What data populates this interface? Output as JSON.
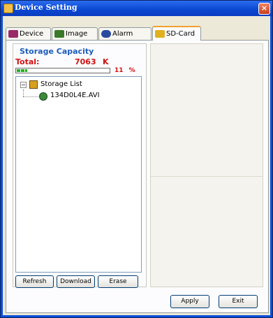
{
  "window": {
    "title": "Device Setting",
    "close_symbol": "×",
    "title_icon": "app-icon"
  },
  "tabs": [
    {
      "label": "Device",
      "icon": "device-icon",
      "color": "#9a2a6a"
    },
    {
      "label": "Image",
      "icon": "image-icon",
      "color": "#3a7a2a"
    },
    {
      "label": "Alarm",
      "icon": "alarm-icon",
      "color": "#2a4aa0"
    },
    {
      "label": "SD-Card",
      "icon": "sd-card-icon",
      "color": "#e0b020",
      "active": true
    }
  ],
  "storage": {
    "title": "Storage Capacity",
    "total_label": "Total:",
    "total_value": "7063",
    "total_unit": "K",
    "percent": "11",
    "percent_unit": "%",
    "usage_fraction": 0.11
  },
  "tree": {
    "expander": "−",
    "root_label": "Storage List",
    "root_icon": "sd-card-icon",
    "items": [
      {
        "label": "134D0L4E.AVI",
        "icon": "video-file-icon"
      }
    ]
  },
  "buttons": {
    "refresh": "Refresh",
    "download": "Download",
    "erase": "Erase",
    "apply": "Apply",
    "exit": "Exit"
  },
  "colors": {
    "title_bar": "#0a46d0",
    "accent_red": "#d01010",
    "heading_blue": "#1c5cb8",
    "progress_green": "#1fb01f"
  }
}
